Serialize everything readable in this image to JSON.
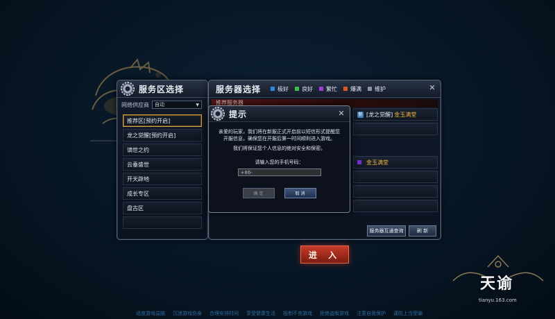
{
  "left_panel": {
    "title": "服务区选择",
    "isp_label": "网络供应商",
    "isp_value": "自动",
    "zones": [
      "推荐区[预约开启]",
      "龙之觉醒[预约开启]",
      "谪世之约",
      "云垂盛世",
      "开天辟地",
      "成长专区",
      "盘古区"
    ]
  },
  "right_panel": {
    "title": "服务器选择",
    "legend": [
      {
        "label": "极好",
        "color": "#2f88d8"
      },
      {
        "label": "良好",
        "color": "#3cc04a"
      },
      {
        "label": "繁忙",
        "color": "#9b3fd8"
      },
      {
        "label": "爆满",
        "color": "#e0562a"
      },
      {
        "label": "维护",
        "color": "#8a94a3"
      }
    ],
    "recommend_label": "推荐服务器",
    "servers": [
      {
        "badge": "新",
        "name": "[龙之觉醒]",
        "suffix": "金玉满堂"
      },
      {
        "badge": "",
        "name": "金玉满堂",
        "suffix": ""
      }
    ],
    "buttons": {
      "interop": "服务器互通查询",
      "refresh": "刷 新"
    }
  },
  "dialog": {
    "title": "提示",
    "message": "亲爱的玩家，我们将在新服正式开启前以短信形式提醒您开服信息，确保您在开服后第一时间顺利进入游戏。",
    "privacy": "我们将保证您个人信息的绝对安全和保密。",
    "prompt": "请输入您的手机号码：",
    "phone_value": "+86-",
    "confirm": "确 定",
    "cancel": "取 消"
  },
  "enter_button": "进 入",
  "logo": {
    "text": "天谕",
    "url": "tianyu.163.com"
  },
  "footer": [
    "适度游戏益脑",
    "沉迷游戏伤身",
    "合理安排时间",
    "享受健康生活",
    "抵制不良游戏",
    "拒绝盗版游戏",
    "注意自我保护",
    "谨防上当受骗"
  ]
}
